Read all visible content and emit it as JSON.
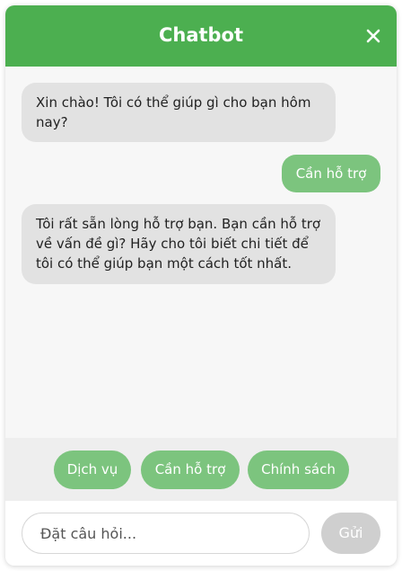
{
  "header": {
    "title": "Chatbot",
    "close_icon": "close-icon",
    "background_color": "#4caf50"
  },
  "messages": [
    {
      "role": "bot",
      "text": "Xin chào! Tôi có thể giúp gì cho bạn hôm nay?"
    },
    {
      "role": "user",
      "text": "Cần hỗ trợ"
    },
    {
      "role": "bot",
      "text": "Tôi rất sẵn lòng hỗ trợ bạn. Bạn cần hỗ trợ về vấn đề gì? Hãy cho tôi biết chi tiết để tôi có thể giúp bạn một cách tốt nhất."
    }
  ],
  "quick_replies": [
    "Dịch vụ",
    "Cần hỗ trợ",
    "Chính sách"
  ],
  "composer": {
    "placeholder": "Đặt câu hỏi...",
    "value": "",
    "send_label": "Gửi"
  },
  "colors": {
    "accent": "#4caf50",
    "user_bubble": "#7cc47e",
    "bot_bubble": "#e2e2e2",
    "send_disabled": "#cfcfcf"
  }
}
